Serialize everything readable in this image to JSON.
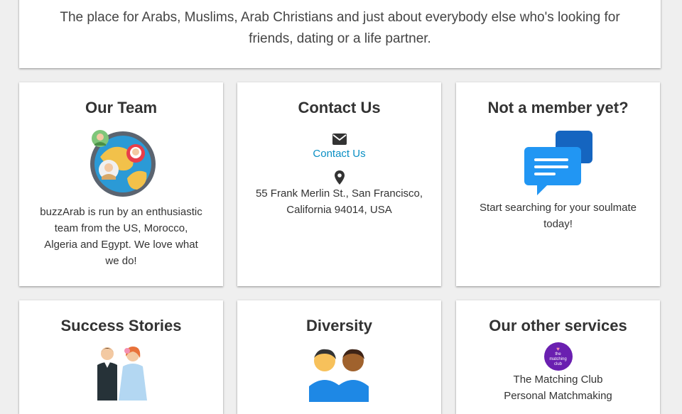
{
  "intro": {
    "text": "The place for Arabs, Muslims, Arab Christians and just about everybody else who's looking for friends, dating or a life partner."
  },
  "team": {
    "title": "Our Team",
    "text": "buzzArab is run by an enthusiastic team from the US, Morocco, Algeria and Egypt. We love what we do!",
    "icon": "team-globe-icon"
  },
  "contact": {
    "title": "Contact Us",
    "link_label": "Contact Us",
    "address": "55 Frank Merlin St., San Francisco, California 94014, USA",
    "mail_icon": "mail-icon",
    "location_icon": "location-pin-icon"
  },
  "member": {
    "title": "Not a member yet?",
    "text": "Start searching for your soulmate today!",
    "icon": "chat-bubbles-icon"
  },
  "success": {
    "title": "Success Stories",
    "icon": "couple-icon"
  },
  "diversity": {
    "title": "Diversity",
    "icon": "two-people-icon"
  },
  "services": {
    "title": "Our other services",
    "logo_text": "the matching club",
    "service_name": "The Matching Club",
    "service_sub": "Personal Matchmaking"
  },
  "colors": {
    "link": "#0a8fc4",
    "chat_blue": "#1e88e5",
    "club_purple": "#6a1fb0"
  }
}
